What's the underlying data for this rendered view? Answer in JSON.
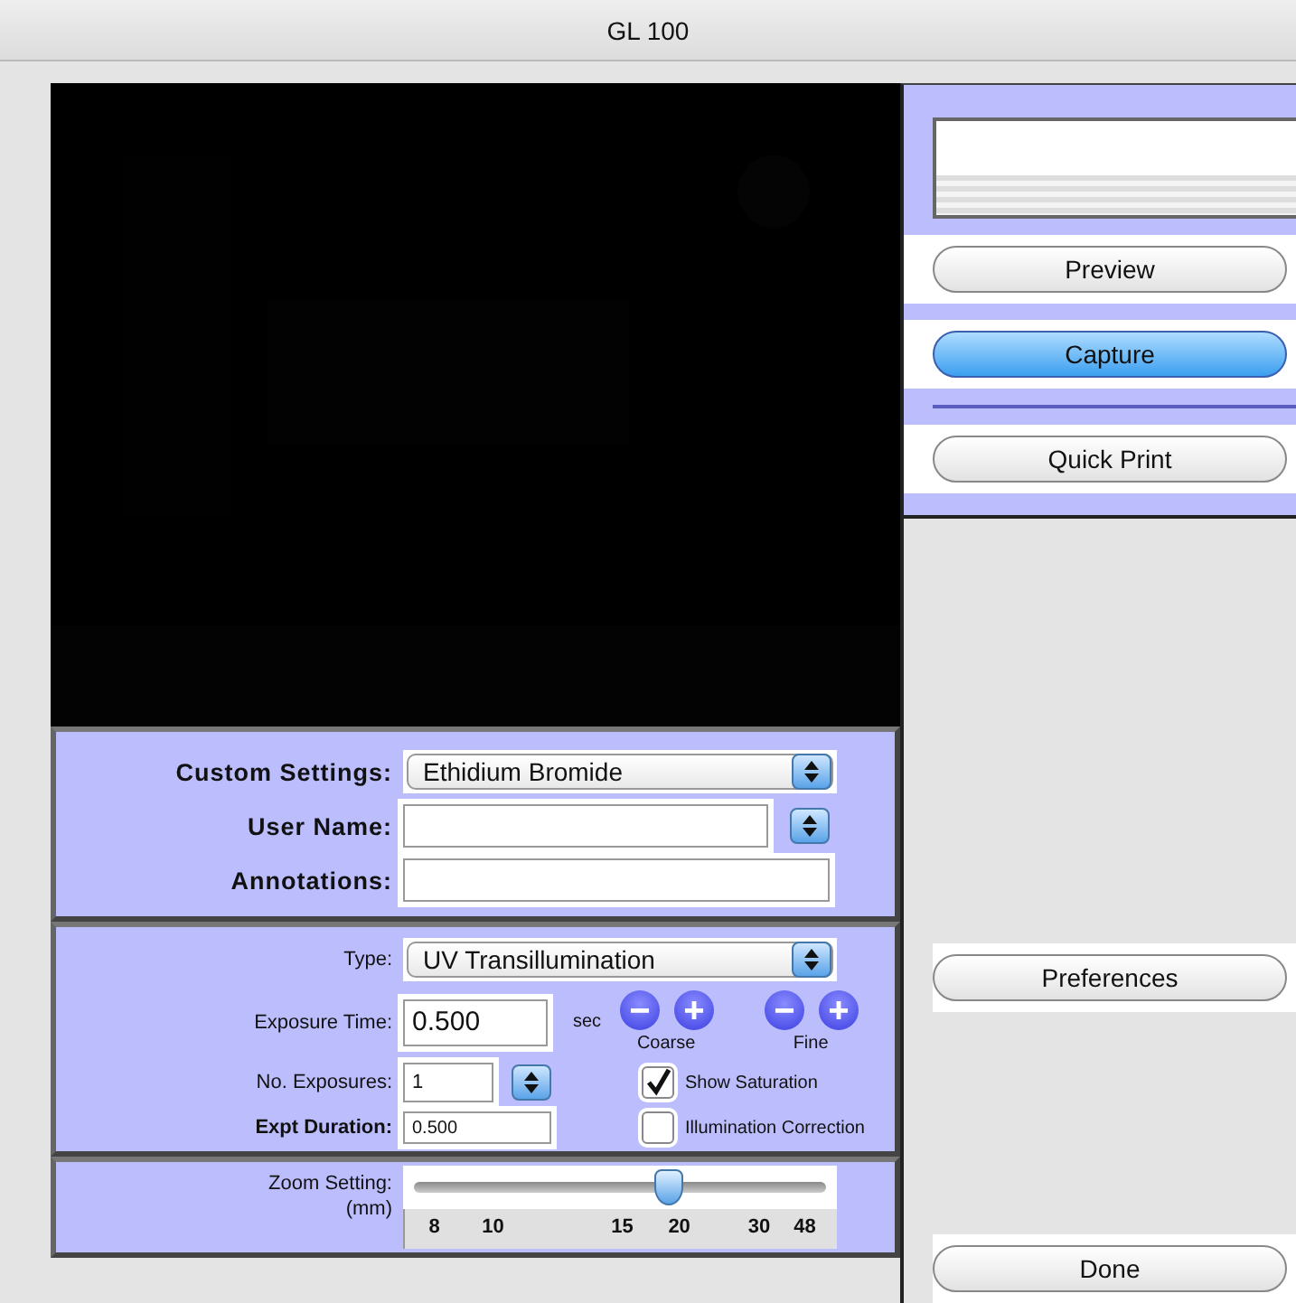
{
  "window": {
    "title": "GL 100"
  },
  "settings": {
    "custom_settings": {
      "label": "Custom Settings:",
      "value": "Ethidium Bromide"
    },
    "user_name": {
      "label": "User Name:"
    },
    "annotations": {
      "label": "Annotations:"
    }
  },
  "exposure": {
    "type": {
      "label": "Type:",
      "value": "UV Transillumination"
    },
    "exposure_time": {
      "label": "Exposure Time:",
      "value": "0.500",
      "unit": "sec",
      "coarse_label": "Coarse",
      "fine_label": "Fine"
    },
    "no_exposures": {
      "label": "No. Exposures:",
      "value": "1"
    },
    "expt_duration": {
      "label": "Expt Duration:",
      "value": "0.500"
    },
    "checkboxes": [
      {
        "label": "Show Saturation",
        "checked": true
      },
      {
        "label": "Illumination Correction",
        "checked": false
      }
    ]
  },
  "zoom": {
    "label": "Zoom Setting:",
    "unit": "(mm)",
    "level": 0.62,
    "ticks": [
      "8",
      "10",
      "15",
      "20",
      "30",
      "48"
    ]
  },
  "actions": [
    {
      "label": "Preview",
      "default": false
    },
    {
      "label": "Capture",
      "default": true
    },
    {
      "label": "Quick Print",
      "default": false
    }
  ],
  "buttons": [
    {
      "label": "Preferences"
    },
    {
      "label": "Done"
    }
  ]
}
